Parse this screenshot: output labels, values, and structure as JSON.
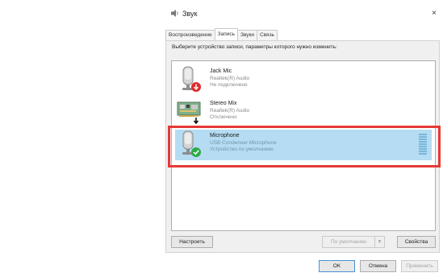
{
  "window": {
    "title": "Звук",
    "close_glyph": "×"
  },
  "tabs": [
    {
      "label": "Воспроизведение",
      "active": false
    },
    {
      "label": "Запись",
      "active": true
    },
    {
      "label": "Звуки",
      "active": false
    },
    {
      "label": "Связь",
      "active": false
    }
  ],
  "instruction": "Выберите устройство записи, параметры которого нужно изменить:",
  "devices": [
    {
      "name": "Jack Mic",
      "driver": "Realtek(R) Audio",
      "status": "Не подключено",
      "icon": "microphone-icon",
      "badge": "red-down-arrow-badge-icon",
      "selected": false
    },
    {
      "name": "Stereo Mix",
      "driver": "Realtek(R) Audio",
      "status": "Отключено",
      "icon": "circuit-board-icon",
      "badge": "black-down-arrow-badge-icon",
      "selected": false
    },
    {
      "name": "Microphone",
      "driver": "USB Condenser Microphone",
      "status": "Устройство по умолчанию",
      "icon": "microphone-icon",
      "badge": "green-check-badge-icon",
      "selected": true
    }
  ],
  "buttons": {
    "configure": "Настроить",
    "set_default": "По умолчанию",
    "set_default_chevron": "▼",
    "properties": "Свойства",
    "ok": "OK",
    "cancel": "Отмена",
    "apply": "Применить"
  },
  "colors": {
    "selection": "#b5dcf2",
    "highlight_box": "#e53935",
    "default_badge": "#2eaa4a",
    "disconnected_badge": "#e02b2b"
  }
}
